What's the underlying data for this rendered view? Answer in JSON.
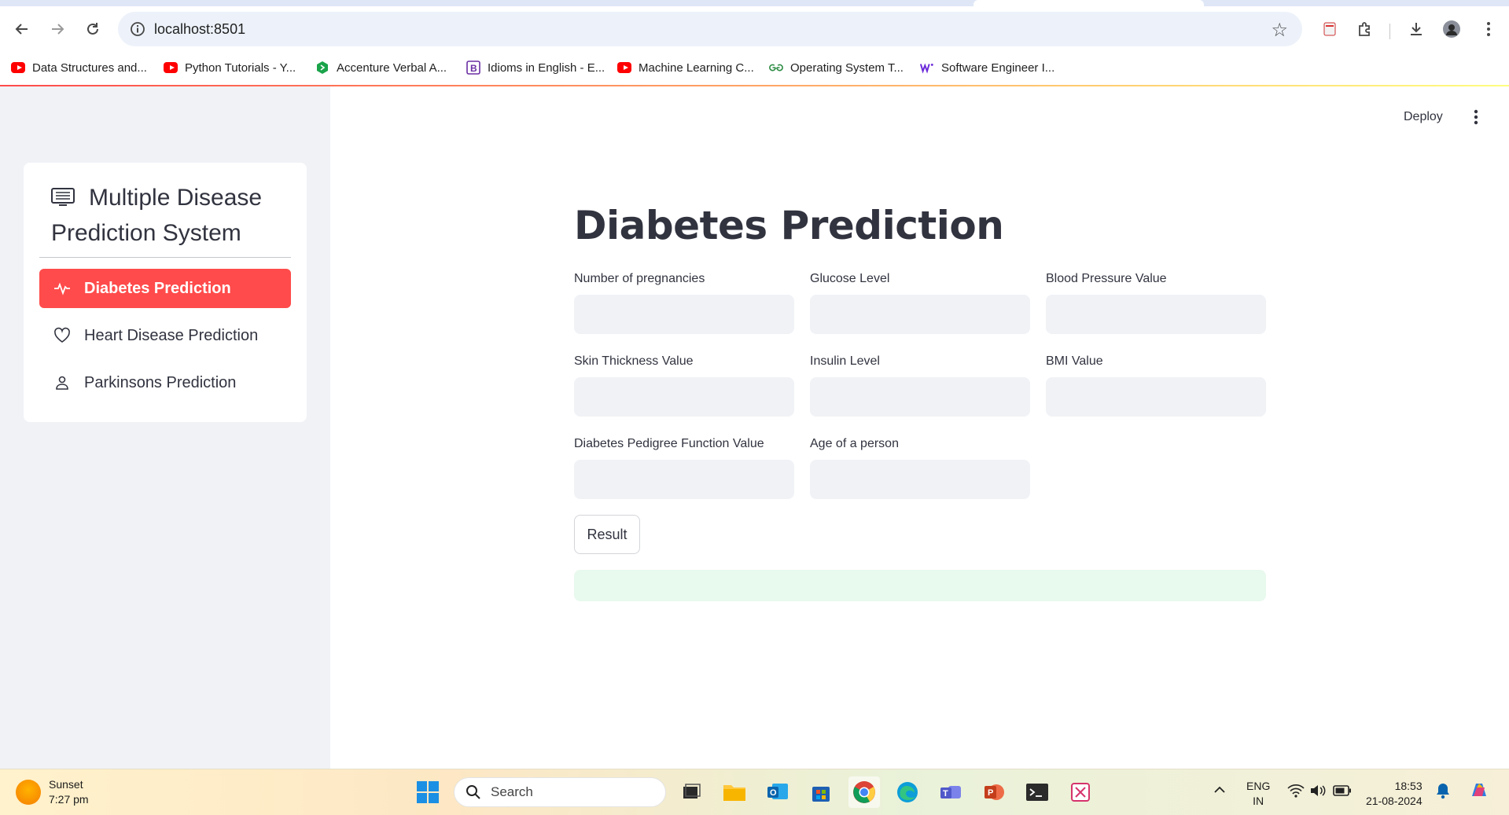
{
  "browser": {
    "url": "localhost:8501",
    "bookmarks": [
      {
        "label": "Data Structures and...",
        "icon": "youtube-icon"
      },
      {
        "label": "Python Tutorials - Y...",
        "icon": "youtube-icon"
      },
      {
        "label": "Accenture Verbal A...",
        "icon": "accenture-icon"
      },
      {
        "label": "Idioms in English - E...",
        "icon": "bookmark-b-icon"
      },
      {
        "label": "Machine Learning C...",
        "icon": "youtube-icon"
      },
      {
        "label": "Operating System T...",
        "icon": "gfg-icon"
      },
      {
        "label": "Software Engineer I...",
        "icon": "wellfound-icon"
      }
    ]
  },
  "sidebar": {
    "menu_title": "Multiple Disease Prediction System",
    "items": [
      {
        "label": "Diabetes Prediction",
        "icon": "activity-icon",
        "active": true
      },
      {
        "label": "Heart Disease Prediction",
        "icon": "heart-icon",
        "active": false
      },
      {
        "label": "Parkinsons Prediction",
        "icon": "person-icon",
        "active": false
      }
    ]
  },
  "header": {
    "deploy_label": "Deploy"
  },
  "main": {
    "title": "Diabetes Prediction",
    "fields": [
      {
        "label": "Number of pregnancies",
        "value": ""
      },
      {
        "label": "Glucose Level",
        "value": ""
      },
      {
        "label": "Blood Pressure Value",
        "value": ""
      },
      {
        "label": "Skin Thickness Value",
        "value": ""
      },
      {
        "label": "Insulin Level",
        "value": ""
      },
      {
        "label": "BMI Value",
        "value": ""
      },
      {
        "label": "Diabetes Pedigree Function Value",
        "value": ""
      },
      {
        "label": "Age of a person",
        "value": ""
      }
    ],
    "button_label": "Result",
    "result_text": ""
  },
  "taskbar": {
    "weather_title": "Sunset",
    "weather_time": "7:27 pm",
    "search_placeholder": "Search",
    "lang_line1": "ENG",
    "lang_line2": "IN",
    "clock_time": "18:53",
    "clock_date": "21-08-2024"
  },
  "colors": {
    "accent": "#ff4b4b",
    "sidebar_bg": "#f0f2f6",
    "success_bg": "#e8f9ee"
  }
}
